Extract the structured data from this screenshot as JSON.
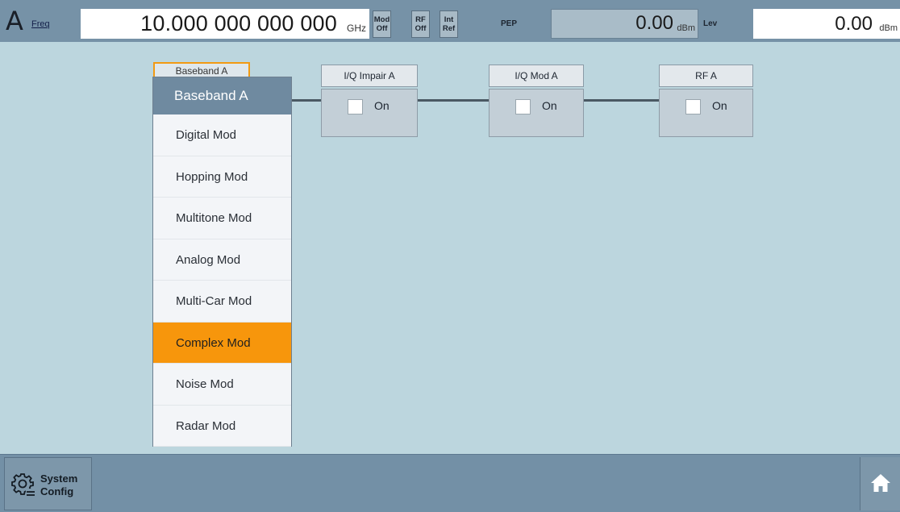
{
  "topbar": {
    "channel": "A",
    "freq_label": "Freq",
    "freq_value": "10.000 000 000 000",
    "freq_unit": "GHz",
    "status_buttons": [
      {
        "line1": "Mod",
        "line2": "Off"
      },
      {
        "line1": "RF",
        "line2": "Off"
      },
      {
        "line1": "Int",
        "line2": "Ref"
      }
    ],
    "pep_label": "PEP",
    "pep_value": "0.00",
    "pep_unit": "dBm",
    "lev_label": "Lev",
    "lev_value": "0.00",
    "lev_unit": "dBm"
  },
  "diagram": {
    "baseband_tab": "Baseband A",
    "blocks": [
      {
        "title": "I/Q Impair A",
        "toggle_label": "On",
        "checked": false
      },
      {
        "title": "I/Q Mod A",
        "toggle_label": "On",
        "checked": false
      },
      {
        "title": "RF A",
        "toggle_label": "On",
        "checked": false
      }
    ]
  },
  "menu": {
    "header": "Baseband A",
    "items": [
      {
        "label": "Digital Mod",
        "active": false
      },
      {
        "label": "Hopping Mod",
        "active": false
      },
      {
        "label": "Multitone Mod",
        "active": false
      },
      {
        "label": "Analog Mod",
        "active": false
      },
      {
        "label": "Multi-Car Mod",
        "active": false
      },
      {
        "label": "Complex Mod",
        "active": true
      },
      {
        "label": "Noise Mod",
        "active": false
      },
      {
        "label": "Radar Mod",
        "active": false
      }
    ]
  },
  "bottombar": {
    "system_line1": "System",
    "system_line2": "Config",
    "system_icon": "gear-icon",
    "home_icon": "home-icon"
  },
  "colors": {
    "background": "#bcd6de",
    "bar": "#7692a7",
    "active_item": "#f7960c",
    "menu_header": "#6f8aa0"
  }
}
